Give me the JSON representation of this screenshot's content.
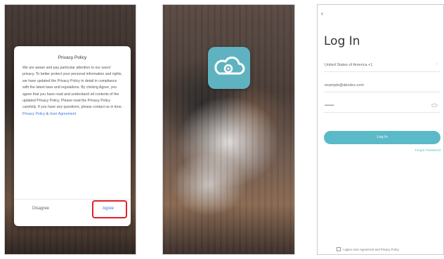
{
  "privacy_dialog": {
    "title": "Privacy Policy",
    "body": "We are aware and pay particular attention to our users' privacy. To better protect your personal information and rights, we have updated the Privacy Policy in detail in compliance with the latest laws and regulations. By clicking Agree, you agree that you have read and understand all contents of the updated Privacy Policy. Please read the Privacy Policy carefully. If you have any questions, please contact us in time.",
    "link_text": "Privacy Policy",
    "agreement_text": "User Agreement",
    "disagree_label": "Disagree",
    "agree_label": "Agree"
  },
  "splash": {
    "logo_icon": "cloud-camera-icon",
    "caption": ""
  },
  "login": {
    "back_icon": "chevron-left-icon",
    "title": "Log In",
    "country": "United States of America +1",
    "email": "example@abcdes.com",
    "password": "•••••••",
    "login_button": "Log In",
    "forgot_password": "Forgot Password",
    "footer_text": "I agree User Agreement and Privacy Policy"
  },
  "colors": {
    "accent": "#5bbac7",
    "highlight": "#e0202a",
    "link": "#3a7bd5"
  }
}
